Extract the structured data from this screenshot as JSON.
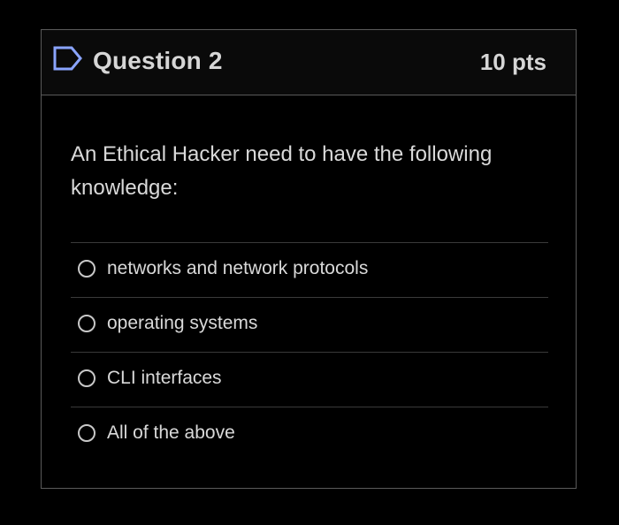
{
  "question": {
    "title": "Question 2",
    "points": "10 pts",
    "flag_icon": "flag-outline-icon",
    "text": "An Ethical Hacker need to have the following knowledge:",
    "answers": [
      {
        "label": "networks and network protocols",
        "selected": false
      },
      {
        "label": "operating systems",
        "selected": false
      },
      {
        "label": "CLI interfaces",
        "selected": false
      },
      {
        "label": "All of the above",
        "selected": false
      }
    ]
  },
  "colors": {
    "background": "#000000",
    "border": "#5a5a5a",
    "text": "#d9d9d9"
  }
}
